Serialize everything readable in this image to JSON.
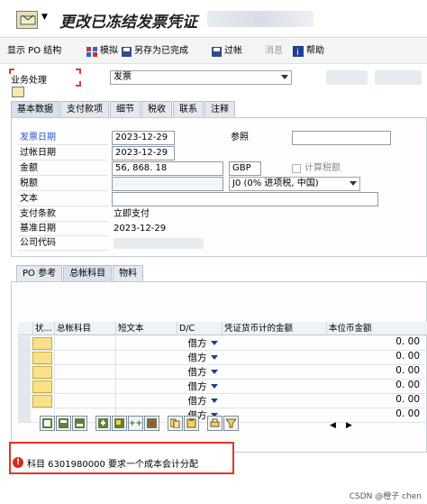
{
  "title": {
    "text": "更改已冻结发票凭证"
  },
  "toolbar": {
    "items": [
      {
        "label": "显示 PO 结构",
        "icon": "po-structure-icon"
      },
      {
        "label": "模拟",
        "icon": "simulate-icon"
      },
      {
        "label": "另存为已完成",
        "icon": "save-completed-icon"
      },
      {
        "label": "过帐",
        "icon": "post-icon"
      },
      {
        "label": "消息",
        "icon": "messages-icon"
      },
      {
        "label": "帮助",
        "icon": "help-icon"
      }
    ]
  },
  "header": {
    "business_label": "业务处理",
    "business_value": "发票"
  },
  "tabs": [
    "基本数据",
    "支付款项",
    "细节",
    "税收",
    "联系",
    "注释"
  ],
  "basic": {
    "invoice_date_label": "发票日期",
    "invoice_date": "2023-12-29",
    "reference_label": "参照",
    "posting_date_label": "过帐日期",
    "posting_date": "2023-12-29",
    "amount_label": "金额",
    "amount": "56, 868. 18",
    "currency": "GBP",
    "calc_tax_label": "计算税额",
    "tax_label": "税额",
    "tax_code": "J0 (0% 进项税, 中国)",
    "text_label": "文本",
    "payment_terms_label": "支付条款",
    "payment_terms": "立即支付",
    "baseline_date_label": "基准日期",
    "baseline_date": "2023-12-29",
    "company_code_label": "公司代码"
  },
  "lower_tabs": [
    "PO 参考",
    "总帐科目",
    "物料"
  ],
  "grid": {
    "headers": [
      "状...",
      "总帐科目",
      "短文本",
      "D/C",
      "凭证货币计的金额",
      "本位币金额"
    ],
    "rows": [
      {
        "dc": "借方",
        "amount": "0. 00"
      },
      {
        "dc": "借方",
        "amount": "0. 00"
      },
      {
        "dc": "借方",
        "amount": "0. 00"
      },
      {
        "dc": "借方",
        "amount": "0. 00"
      },
      {
        "dc": "借方",
        "amount": "0. 00"
      },
      {
        "dc": "借方",
        "amount": "0. 00"
      }
    ]
  },
  "grid_buttons": {
    "insert_label": "++"
  },
  "status": {
    "message": "科目 6301980000 要求一个成本会计分配"
  },
  "watermark": "CSDN @橙子 chen"
}
